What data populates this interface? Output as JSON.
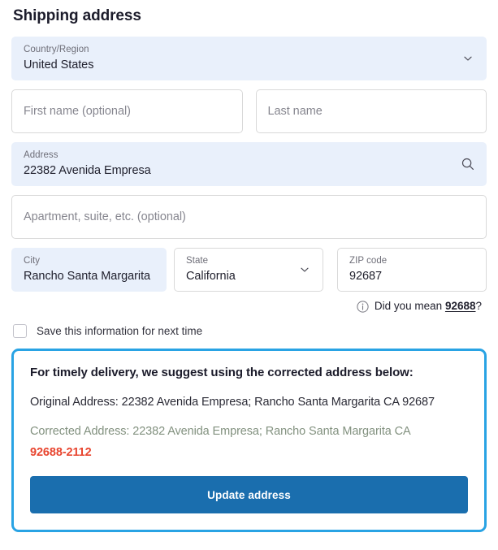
{
  "page_title": "Shipping address",
  "colors": {
    "accent_blue": "#1a6eae",
    "highlight_border": "#29a3e4",
    "filled_field_bg": "#e9f0fb",
    "error_red": "#e8452f",
    "corrected_green": "#82917f"
  },
  "fields": {
    "country": {
      "label": "Country/Region",
      "value": "United States",
      "icon": "chevron-down-icon"
    },
    "first_name": {
      "placeholder": "First name (optional)",
      "value": ""
    },
    "last_name": {
      "placeholder": "Last name",
      "value": ""
    },
    "address": {
      "label": "Address",
      "value": "22382 Avenida Empresa",
      "icon": "search-icon"
    },
    "apartment": {
      "placeholder": "Apartment, suite, etc. (optional)",
      "value": ""
    },
    "city": {
      "label": "City",
      "value": "Rancho Santa Margarita"
    },
    "state": {
      "label": "State",
      "value": "California",
      "icon": "chevron-down-icon"
    },
    "zip": {
      "label": "ZIP code",
      "value": "92687"
    }
  },
  "hint": {
    "icon": "info-circle-icon",
    "prefix": "Did you mean ",
    "suggested_zip": "92688",
    "suffix": "?"
  },
  "save_checkbox": {
    "label": "Save this information for next time",
    "checked": false
  },
  "suggestion": {
    "heading": "For timely delivery, we suggest using the corrected address below:",
    "original_label": "Original Address: 22382 Avenida Empresa; Rancho Santa Margarita CA 92687",
    "corrected_label": "Corrected Address: 22382 Avenida Empresa; Rancho Santa Margarita CA",
    "corrected_zip": "92688-2112",
    "update_button": "Update address"
  }
}
